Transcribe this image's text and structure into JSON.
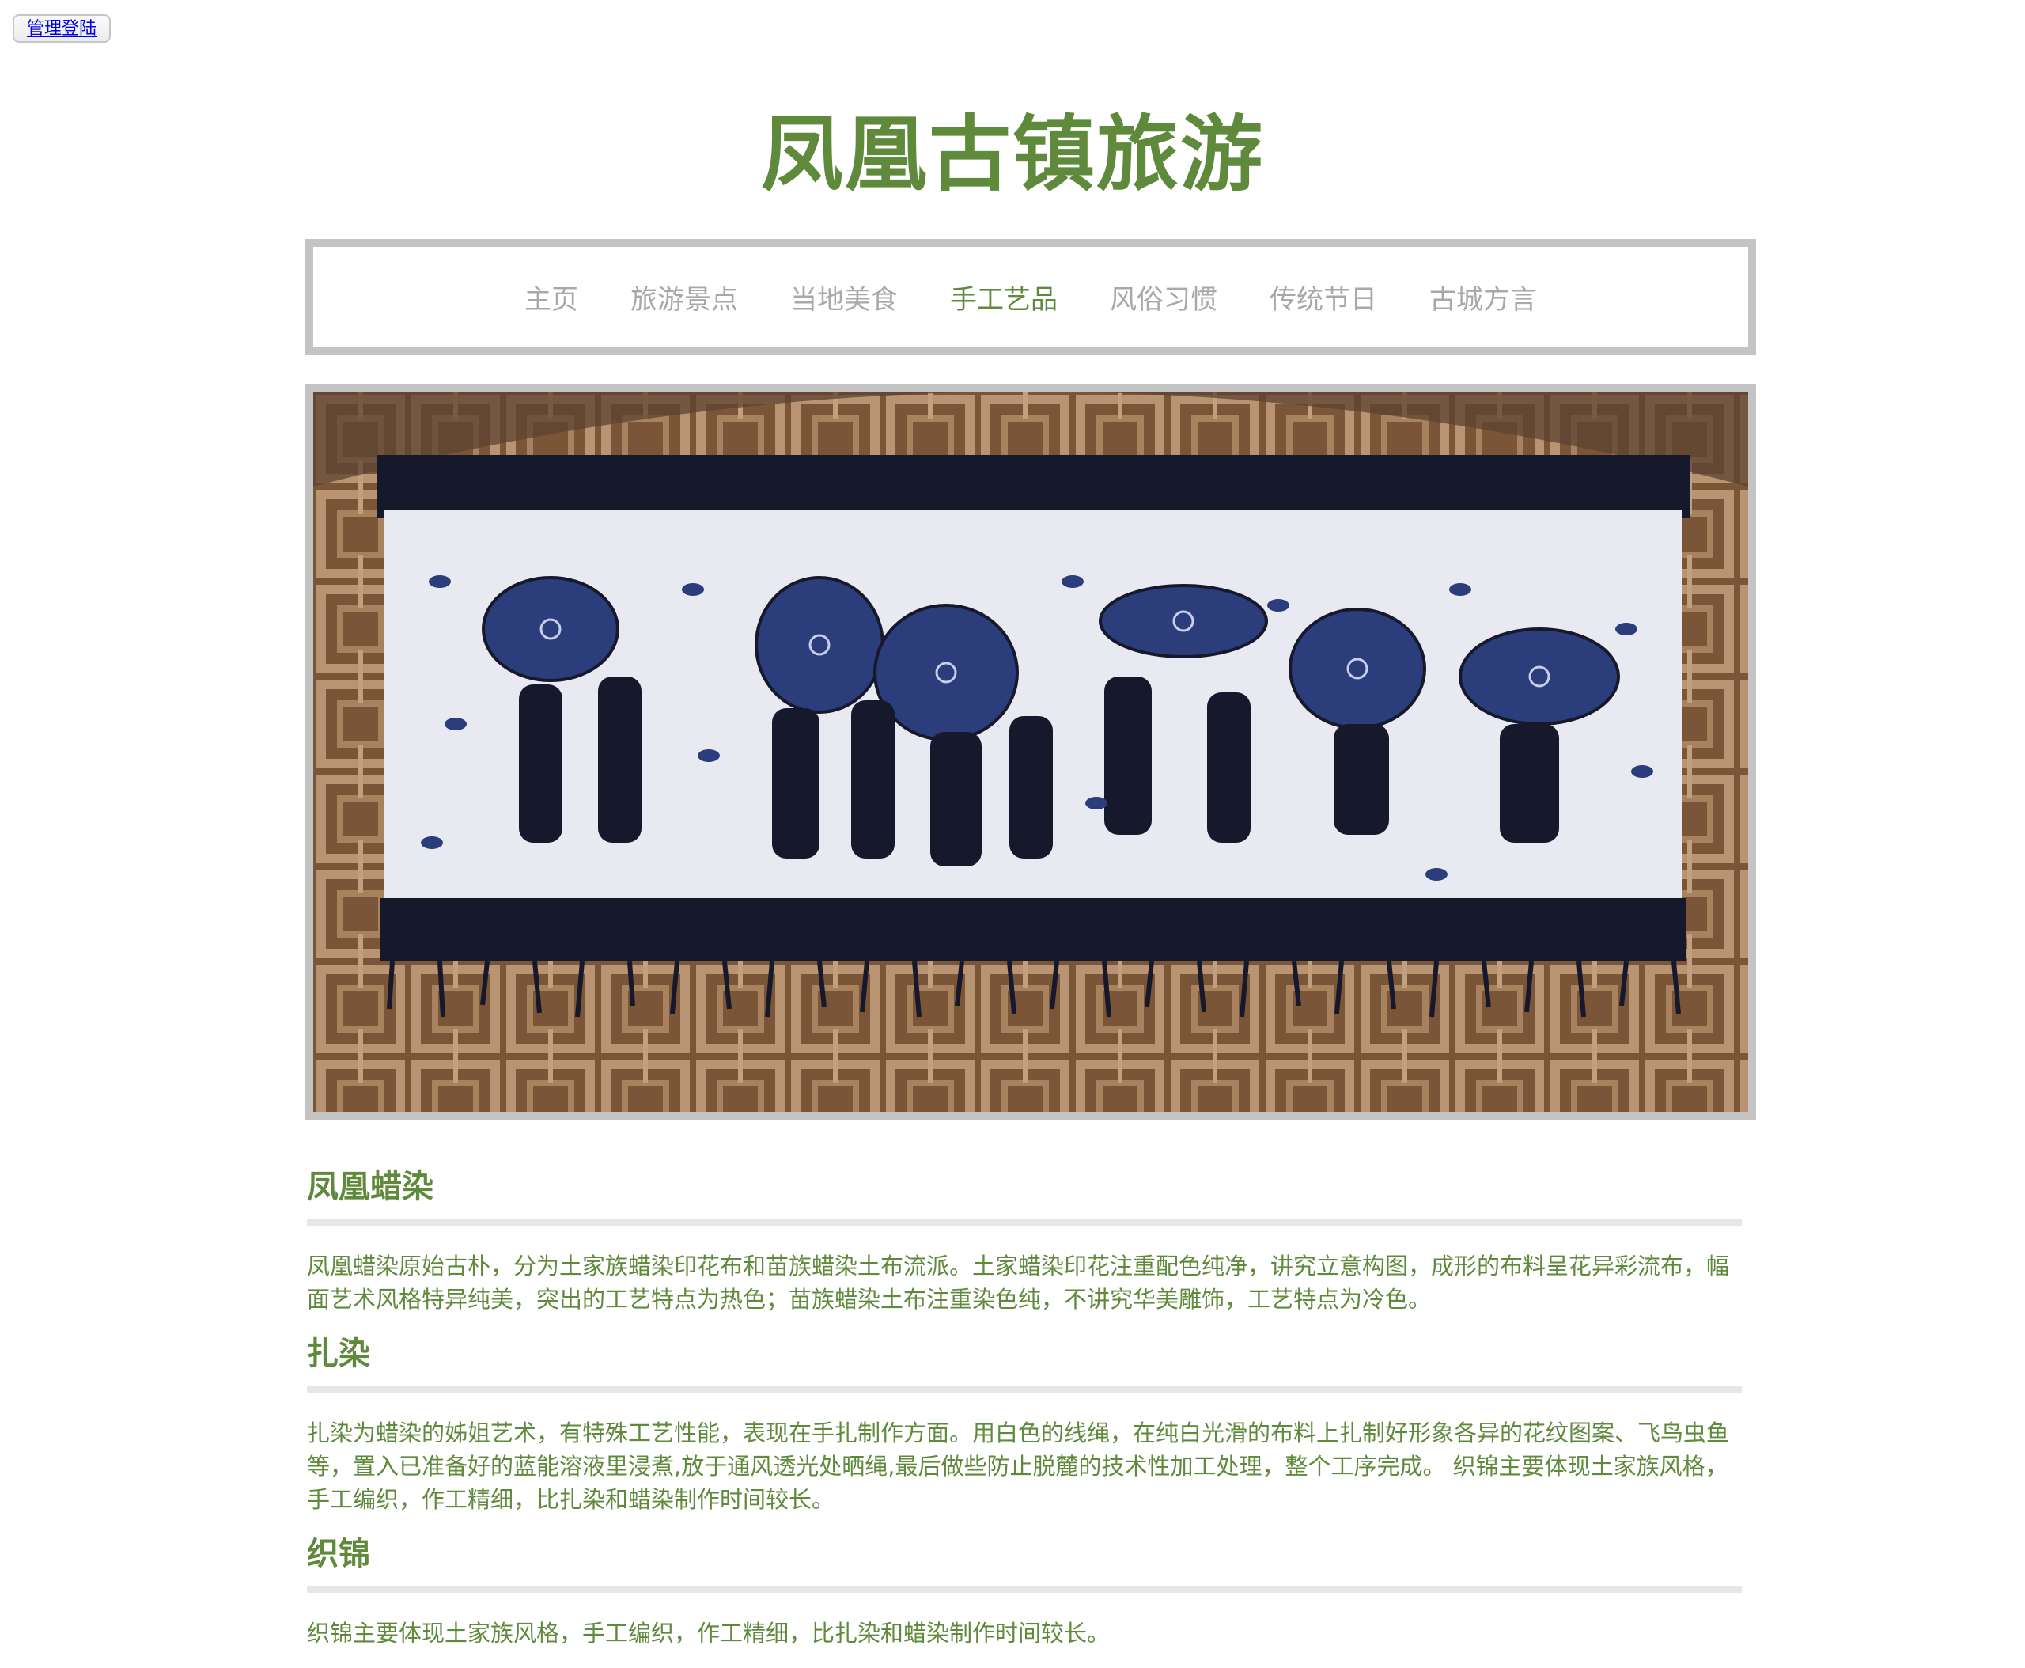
{
  "admin": {
    "label": "管理登陆"
  },
  "header": {
    "title": "凤凰古镇旅游"
  },
  "nav": {
    "items": [
      {
        "label": "主页",
        "active": false
      },
      {
        "label": "旅游景点",
        "active": false
      },
      {
        "label": "当地美食",
        "active": false
      },
      {
        "label": "手工艺品",
        "active": true
      },
      {
        "label": "风俗习惯",
        "active": false
      },
      {
        "label": "传统节日",
        "active": false
      },
      {
        "label": "古城方言",
        "active": false
      }
    ]
  },
  "hero": {
    "image": "batik-wall-hanging-with-umbrella-figures"
  },
  "sections": [
    {
      "title": "凤凰蜡染",
      "text": "凤凰蜡染原始古朴，分为土家族蜡染印花布和苗族蜡染土布流派。土家蜡染印花注重配色纯净，讲究立意构图，成形的布料呈花异彩流布，幅面艺术风格特异纯美，突出的工艺特点为热色；苗族蜡染土布注重染色纯，不讲究华美雕饰，工艺特点为冷色。"
    },
    {
      "title": "扎染",
      "text": "扎染为蜡染的姊姐艺术，有特殊工艺性能，表现在手扎制作方面。用白色的线绳，在纯白光滑的布料上扎制好形象各异的花纹图案、飞鸟虫鱼等，置入已准备好的蓝能溶液里浸煮,放于通风透光处晒绳,最后做些防止脱麓的技术性加工处理，整个工序完成。 织锦主要体现土家族风格，手工编织，作工精细，比扎染和蜡染制作时间较长。"
    },
    {
      "title": "织锦",
      "text": "织锦主要体现土家族风格，手工编织，作工精细，比扎染和蜡染制作时间较长。"
    }
  ],
  "colors": {
    "accent": "#5f8a3b",
    "nav_inactive": "#a8a8a8",
    "border": "#c4c4c4"
  }
}
